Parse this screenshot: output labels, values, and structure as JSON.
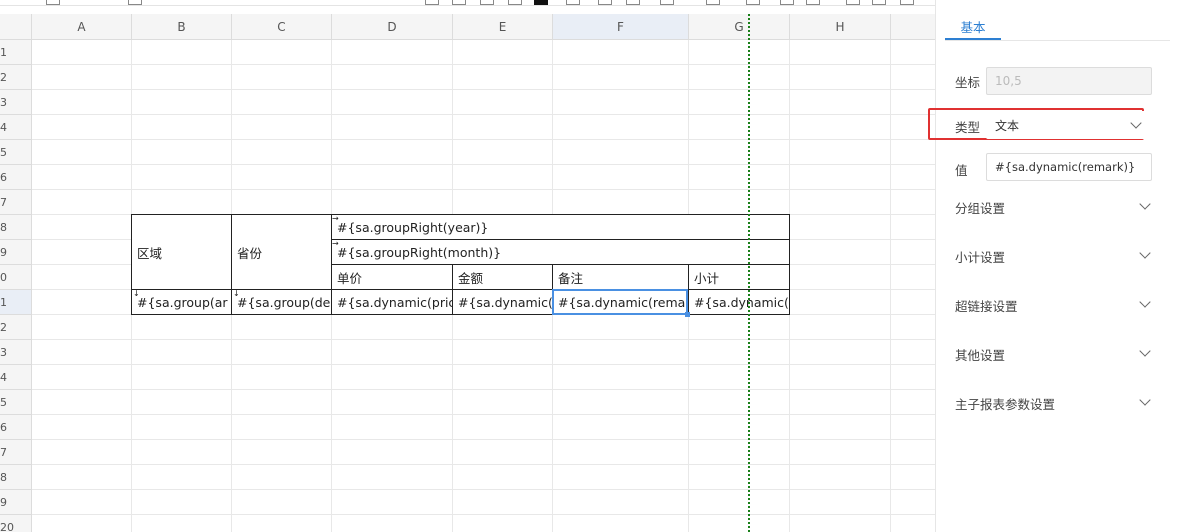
{
  "sheet": {
    "columns": [
      "A",
      "B",
      "C",
      "D",
      "E",
      "F",
      "G",
      "H"
    ],
    "rows": [
      "1",
      "2",
      "3",
      "4",
      "5",
      "6",
      "7",
      "8",
      "9",
      "0",
      "1",
      "2",
      "3",
      "4",
      "5",
      "6",
      "7",
      "8",
      "9",
      "20"
    ],
    "cells": {
      "b8": "区域",
      "c8": "省份",
      "d8": "#{sa.groupRight(year)}",
      "d9": "#{sa.groupRight(month)}",
      "d10": "单价",
      "e10": "金额",
      "f10": "备注",
      "g10": "小计",
      "b11": "#{sa.group(ar",
      "c11": "#{sa.group(de",
      "d11": "#{sa.dynamic(pric",
      "e11": "#{sa.dynamic(",
      "f11": "#{sa.dynamic(remar",
      "g11": "#{sa.dynamic("
    }
  },
  "panel": {
    "tab_label": "基本",
    "coord_label": "坐标",
    "coord_value": "10,5",
    "type_label": "类型",
    "type_value": "文本",
    "value_label": "值",
    "value_value": "#{sa.dynamic(remark)}",
    "sections": [
      "分组设置",
      "小计设置",
      "超链接设置",
      "其他设置",
      "主子报表参数设置"
    ]
  },
  "colors": {
    "accent": "#2d7fd2",
    "highlight": "#e03131",
    "page_break": "#1a7f1a"
  }
}
